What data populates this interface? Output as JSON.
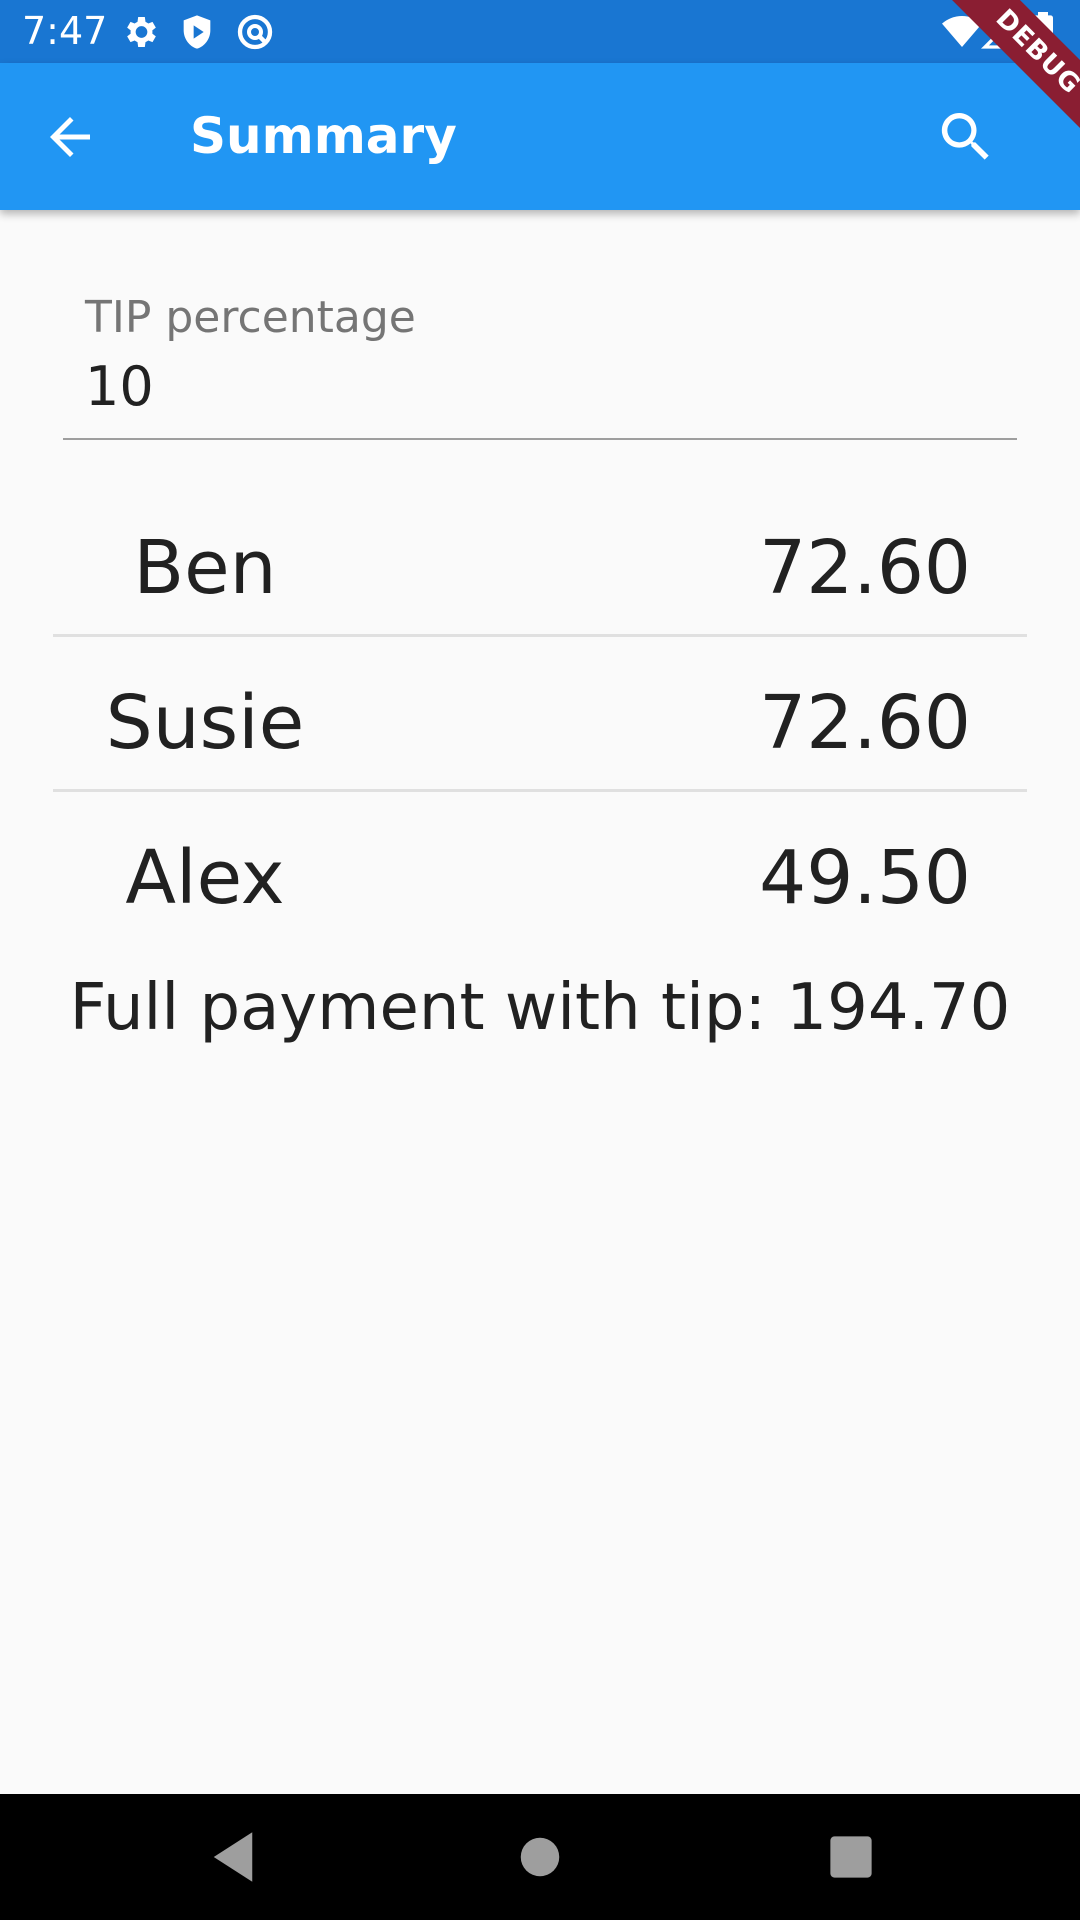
{
  "status_bar": {
    "time": "7:47",
    "icons": [
      "settings-gear-icon",
      "shield-play-icon",
      "circle-at-icon",
      "wifi-icon",
      "cellular-signal-icon",
      "battery-icon"
    ],
    "background": "#1976d2"
  },
  "app_bar": {
    "title": "Summary",
    "back_icon": "arrow-back-icon",
    "search_icon": "search-icon",
    "background": "#2196f3"
  },
  "debug_banner": {
    "label": "DEBUG",
    "color": "#8a1e32"
  },
  "tip_field": {
    "label": "TIP percentage",
    "value": "10"
  },
  "people": [
    {
      "name": "Ben",
      "amount": "72.60"
    },
    {
      "name": "Susie",
      "amount": "72.60"
    },
    {
      "name": "Alex",
      "amount": "49.50"
    }
  ],
  "total": {
    "text": "Full payment with tip: 194.70"
  },
  "nav_bar": {
    "buttons": [
      "back-triangle-icon",
      "home-circle-icon",
      "recents-square-icon"
    ]
  }
}
